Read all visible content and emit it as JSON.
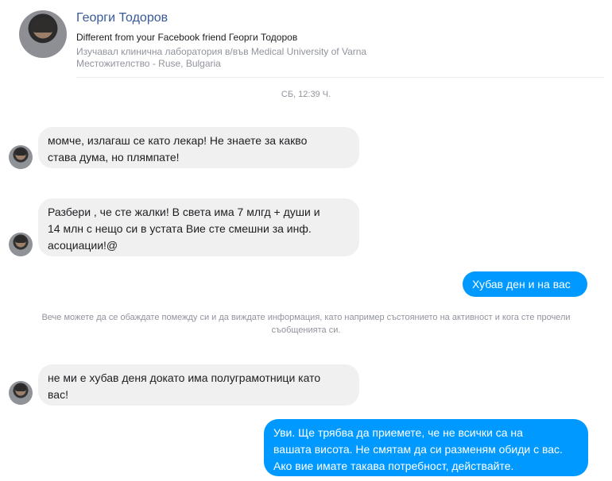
{
  "profile": {
    "name": "Георги Тодоров",
    "line1": "Different from your Facebook friend Георги Тодоров",
    "line2": "Изучавал клинична лаборатория в/във Medical University of Varna",
    "line3": "Местожителство - Ruse, Bulgaria"
  },
  "conversation": {
    "timestamp": "СБ, 12:39 Ч.",
    "messages": [
      {
        "from": "them",
        "text": "момче, излагаш се като лекар! Не знаете за какво\nстава дума, но плямпате!"
      },
      {
        "from": "them",
        "text": "Разбери , че сте жалки! В света има 7 млгд + души и\n14 млн с нещо си в устата Вие сте смешни за инф.\nасоциации!@"
      },
      {
        "from": "me",
        "text": "Хубав ден и  на вас"
      },
      {
        "from": "them",
        "text": "не ми е хубав деня докато има полуграмотници като\nвас!"
      },
      {
        "from": "me",
        "text": "Уви. Ще трябва да приемете, че не всички са на\nвашата висота. Не смятам да си разменям обиди с вас.\nАко вие имате такава потребност, действайте."
      }
    ],
    "notice": "Вече можете да се обаждате помежду си и да виждате информация, като например състоянието на активност и кога сте прочели съобщенията си."
  },
  "colors": {
    "outgoing": "#0099ff",
    "incoming": "#f1f0f0",
    "name": "#385898",
    "muted": "#90949c"
  }
}
